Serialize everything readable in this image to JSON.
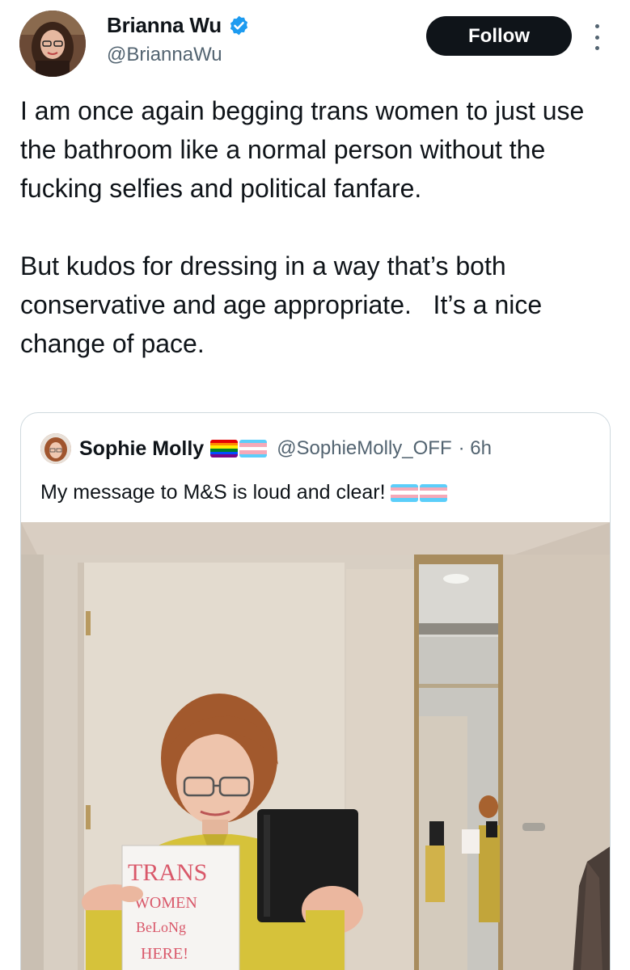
{
  "author": {
    "display_name": "Brianna Wu",
    "handle": "@BriannaWu",
    "verified": true,
    "avatar_icon": "profile-photo"
  },
  "actions": {
    "follow_label": "Follow",
    "more_icon": "more-vertical-icon"
  },
  "tweet": {
    "paragraph_1": "I am once again begging trans women to just use the bathroom like a normal person without the fucking selfies and political fanfare.",
    "paragraph_2": "But kudos for dressing in a way that’s both conservative and age appropriate.   It’s a nice change of pace."
  },
  "quoted_tweet": {
    "display_name": "Sophie Molly",
    "handle": "@SophieMolly_OFF",
    "time": "· 6h",
    "text": "My message to M&S is loud and clear!",
    "name_flags": [
      "rainbow-flag-emoji",
      "trans-flag-emoji"
    ],
    "text_flags": [
      "trans-flag-emoji",
      "trans-flag-emoji"
    ],
    "photo": {
      "sign_lines": [
        "TRANS",
        "WOMEN",
        "BeLoNg",
        "HERE!"
      ]
    }
  },
  "colors": {
    "text": "#0f1419",
    "secondary_text": "#536471",
    "verified_blue": "#1d9bf0",
    "button_bg": "#0f1419",
    "border": "#cfd9de"
  }
}
